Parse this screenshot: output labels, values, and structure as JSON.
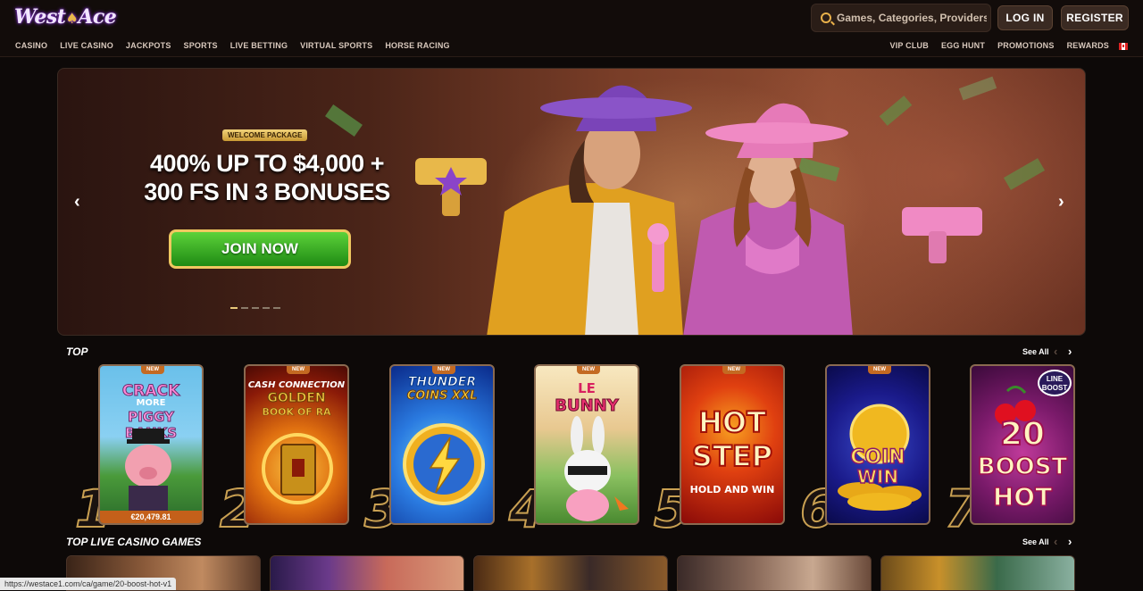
{
  "header": {
    "logo_text": "West",
    "logo_text2": "Ace",
    "search_placeholder": "Games, Categories, Providers",
    "login_label": "LOG IN",
    "register_label": "REGISTER"
  },
  "nav": {
    "left": [
      "CASINO",
      "LIVE CASINO",
      "JACKPOTS",
      "SPORTS",
      "LIVE BETTING",
      "VIRTUAL SPORTS",
      "HORSE RACING"
    ],
    "right": [
      "VIP CLUB",
      "EGG HUNT",
      "PROMOTIONS",
      "REWARDS"
    ]
  },
  "hero": {
    "badge": "WELCOME PACKAGE",
    "headline_line1": "400% UP TO $4,000 +",
    "headline_line2": "300 FS IN 3 BONUSES",
    "cta": "JOIN NOW",
    "prev_arrow": "‹",
    "next_arrow": "›",
    "slide_count": 5,
    "active_slide": 1
  },
  "top_section": {
    "title": "TOP",
    "see_all": "See All",
    "games": [
      {
        "rank": "1",
        "tag": "NEW",
        "title_lines": [
          "CRACK",
          "MORE",
          "PIGGY BANKS"
        ],
        "jackpot": "€20,479.81"
      },
      {
        "rank": "2",
        "tag": "NEW",
        "title_lines": [
          "CASH CONNECTION",
          "GOLDEN",
          "BOOK OF RA"
        ]
      },
      {
        "rank": "3",
        "tag": "NEW",
        "title_lines": [
          "THUNDER",
          "COINS XXL"
        ]
      },
      {
        "rank": "4",
        "tag": "NEW",
        "title_lines": [
          "LE",
          "BUNNY"
        ]
      },
      {
        "rank": "5",
        "tag": "NEW",
        "title_lines": [
          "HOT",
          "STEP",
          "HOLD AND WIN"
        ]
      },
      {
        "rank": "6",
        "tag": "NEW",
        "title_lines": [
          "COIN",
          "WIN"
        ]
      },
      {
        "rank": "7",
        "tag": "",
        "title_lines": [
          "LINE",
          "BOOST",
          "20",
          "BOOST",
          "HOT"
        ]
      }
    ]
  },
  "live_section": {
    "title": "TOP LIVE CASINO GAMES",
    "see_all": "See All"
  },
  "status_url": "https://westace1.com/ca/game/20-boost-hot-v1",
  "colors": {
    "accent_gold": "#e8b04a",
    "join_green": "#3fb42a",
    "rank_stroke": "#c9a052"
  }
}
